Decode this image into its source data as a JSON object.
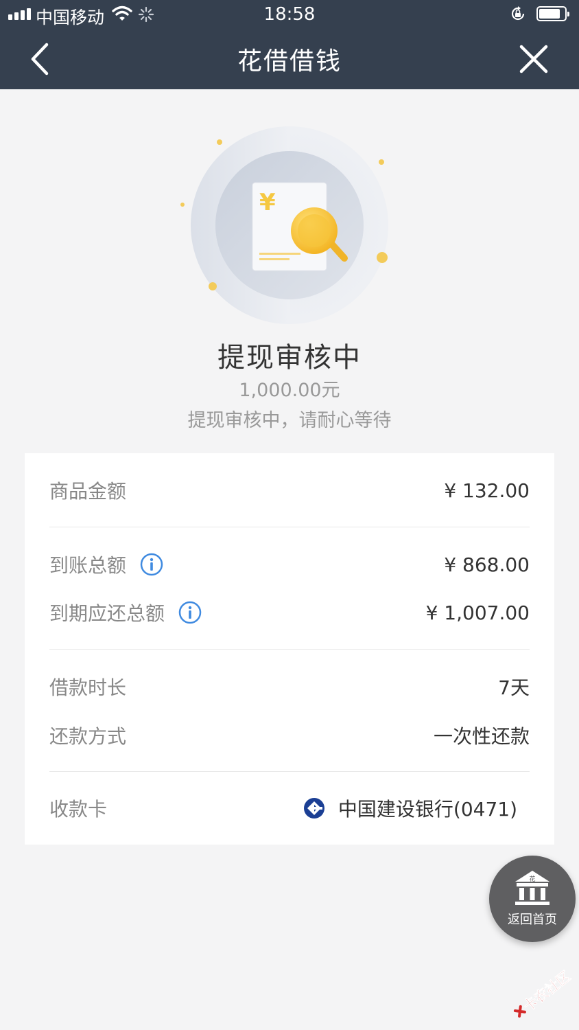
{
  "status_bar": {
    "carrier": "中国移动",
    "time": "18:58"
  },
  "nav": {
    "title": "花借借钱"
  },
  "result": {
    "title": "提现审核中",
    "amount": "1,000.00元",
    "description": "提现审核中，请耐心等待"
  },
  "details": {
    "goods_amount": {
      "label": "商品金额",
      "value": "¥ 132.00"
    },
    "received_total": {
      "label": "到账总额",
      "value": "¥ 868.00"
    },
    "due_total": {
      "label": "到期应还总额",
      "value": "¥ 1,007.00"
    },
    "loan_term": {
      "label": "借款时长",
      "value": "7天"
    },
    "repay_method": {
      "label": "还款方式",
      "value": "一次性还款"
    },
    "receiving_card": {
      "label": "收款卡",
      "value": "中国建设银行(0471)"
    }
  },
  "home_button": {
    "label": "返回首页",
    "icon_char": "花"
  },
  "watermark": {
    "text": "卡农社区"
  },
  "icons": {
    "back": "chevron-left-icon",
    "close": "close-icon",
    "info": "info-icon",
    "bank": "ccb-bank-icon",
    "home": "bank-building-icon"
  },
  "colors": {
    "nav_background": "#35404f",
    "page_background": "#f4f4f5",
    "info_blue": "#3f8ae0",
    "ccb_blue": "#1b3f94",
    "gold": "#f7c43a"
  }
}
